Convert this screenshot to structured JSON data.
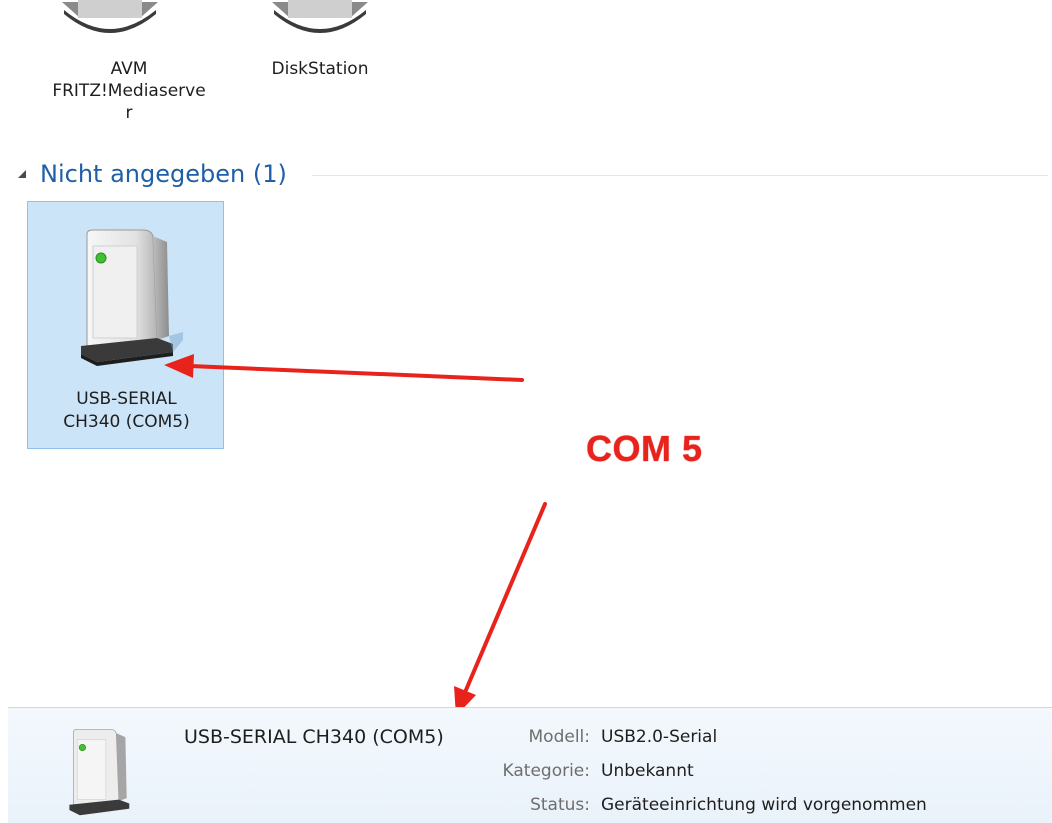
{
  "devices_top": [
    {
      "label": "AVM FRITZ!Mediaserver",
      "label_lines": [
        "AVM",
        "FRITZ!Mediaserve",
        "r"
      ],
      "icon": "network-device-icon"
    },
    {
      "label": "DiskStation",
      "label_lines": [
        "DiskStation"
      ],
      "icon": "network-device-icon"
    }
  ],
  "group": {
    "title": "Nicht angegeben (1)",
    "expand_icon": "collapse-arrow-icon"
  },
  "selected_device": {
    "label_lines": [
      "USB-SERIAL",
      "CH340 (COM5)"
    ],
    "icon": "generic-device-icon"
  },
  "annotation": {
    "text": "COM 5",
    "color": "#e8231b"
  },
  "details": {
    "name": "USB-SERIAL CH340 (COM5)",
    "properties": [
      {
        "key": "Modell:",
        "value": "USB2.0-Serial"
      },
      {
        "key": "Kategorie:",
        "value": "Unbekannt"
      },
      {
        "key": "Status:",
        "value": "Geräteeinrichtung wird vorgenommen"
      }
    ]
  },
  "colors": {
    "group_title": "#1f5fa8",
    "selection_bg": "#cce4f7",
    "selection_border": "#8fc1ec"
  }
}
